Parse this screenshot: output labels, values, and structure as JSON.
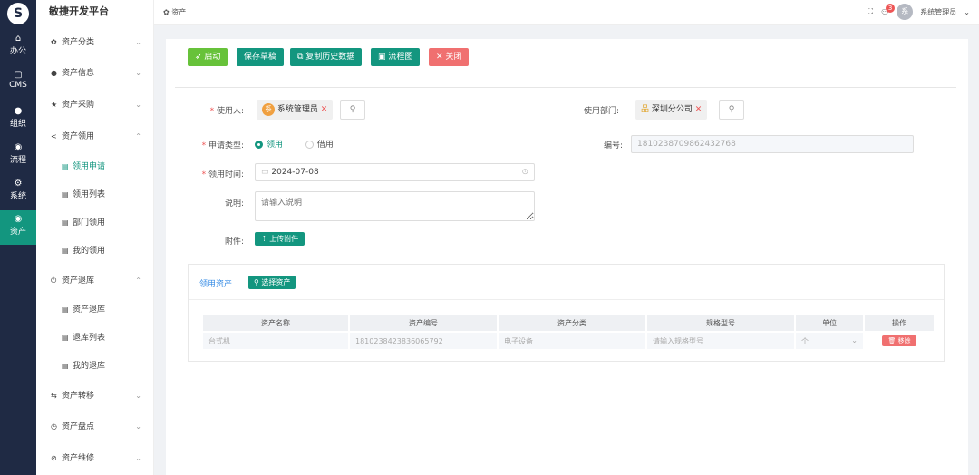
{
  "rail": {
    "logo": "S",
    "items": [
      {
        "icon": "⌂",
        "label": "办公"
      },
      {
        "icon": "▢",
        "label": "CMS"
      },
      {
        "icon": "●",
        "label": "组织"
      },
      {
        "icon": "◉",
        "label": "流程"
      },
      {
        "icon": "⚙",
        "label": "系统"
      },
      {
        "icon": "◉",
        "label": "资产"
      }
    ]
  },
  "sidebar": {
    "brand": "敏捷开发平台",
    "items": [
      {
        "icon": "✿",
        "label": "资产分类",
        "chev": "⌄"
      },
      {
        "icon": "●",
        "label": "资产信息",
        "chev": "⌄"
      },
      {
        "icon": "★",
        "label": "资产采购",
        "chev": "⌄"
      },
      {
        "icon": "<",
        "label": "资产领用",
        "chev": "⌃"
      },
      {
        "icon": "▤",
        "label": "领用申请"
      },
      {
        "icon": "▤",
        "label": "领用列表"
      },
      {
        "icon": "▤",
        "label": "部门领用"
      },
      {
        "icon": "▤",
        "label": "我的领用"
      },
      {
        "icon": "⏻",
        "label": "资产退库",
        "chev": "⌃"
      },
      {
        "icon": "▤",
        "label": "资产退库"
      },
      {
        "icon": "▤",
        "label": "退库列表"
      },
      {
        "icon": "▤",
        "label": "我的退库"
      },
      {
        "icon": "⇆",
        "label": "资产转移",
        "chev": "⌄"
      },
      {
        "icon": "◷",
        "label": "资产盘点",
        "chev": "⌄"
      },
      {
        "icon": "⊘",
        "label": "资产维修",
        "chev": "⌄"
      }
    ]
  },
  "topbar": {
    "breadcrumb": "资产",
    "badge": "3",
    "avatar": "系",
    "user": "系统管理员"
  },
  "toolbar": {
    "start": "启动",
    "save": "保存草稿",
    "copy": "复制历史数据",
    "flow": "流程图",
    "close": "关闭"
  },
  "form": {
    "user_label": "使用人:",
    "user_avatar": "系",
    "user_value": "系统管理员",
    "dept_label": "使用部门:",
    "dept_value": "深圳分公司",
    "type_label": "申请类型:",
    "type_options": [
      "领用",
      "借用"
    ],
    "code_label": "编号:",
    "code_value": "1810238709862432768",
    "time_label": "领用时间:",
    "time_value": "2024-07-08",
    "desc_label": "说明:",
    "desc_placeholder": "请输入说明",
    "attach_label": "附件:",
    "upload": "上传附件"
  },
  "assets": {
    "title": "领用资产",
    "select": "选择资产",
    "columns": [
      "资产名称",
      "资产编号",
      "资产分类",
      "规格型号",
      "单位",
      "操作"
    ],
    "rows": [
      {
        "name": "台式机",
        "code": "1810238423836065792",
        "category": "电子设备",
        "spec_placeholder": "请输入规格型号",
        "unit": "个",
        "action": "移除"
      }
    ]
  },
  "colors": {
    "primary": "#13967f",
    "success": "#67c23a",
    "danger": "#f07070",
    "rail": "#1f2a44"
  }
}
